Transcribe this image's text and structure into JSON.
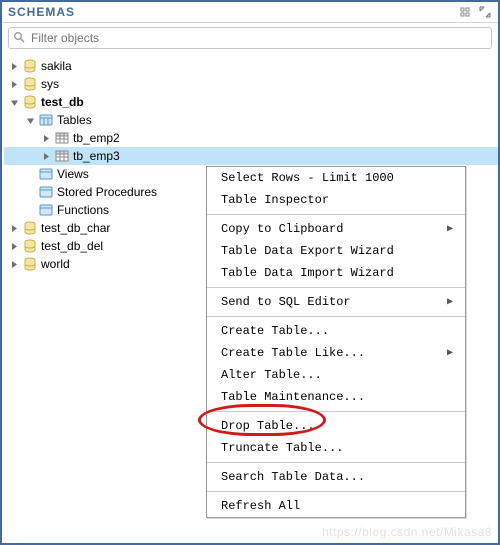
{
  "header": {
    "title": "SCHEMAS"
  },
  "search": {
    "placeholder": "Filter objects"
  },
  "tree": {
    "sakila": "sakila",
    "sys": "sys",
    "test_db": "test_db",
    "tables": "Tables",
    "tb_emp2": "tb_emp2",
    "tb_emp3": "tb_emp3",
    "views": "Views",
    "stored_procedures": "Stored Procedures",
    "functions": "Functions",
    "test_db_char": "test_db_char",
    "test_db_del": "test_db_del",
    "world": "world"
  },
  "menu": {
    "select_rows": "Select Rows - Limit 1000",
    "table_inspector": "Table Inspector",
    "copy_clipboard": "Copy to Clipboard",
    "export_wizard": "Table Data Export Wizard",
    "import_wizard": "Table Data Import Wizard",
    "send_sql": "Send to SQL Editor",
    "create_table": "Create Table...",
    "create_table_like": "Create Table Like...",
    "alter_table": "Alter Table...",
    "table_maintenance": "Table Maintenance...",
    "drop_table": "Drop Table...",
    "truncate_table": "Truncate Table...",
    "search_table_data": "Search Table Data...",
    "refresh_all": "Refresh All"
  },
  "watermark": "https://blog.csdn.net/Mikasa8"
}
